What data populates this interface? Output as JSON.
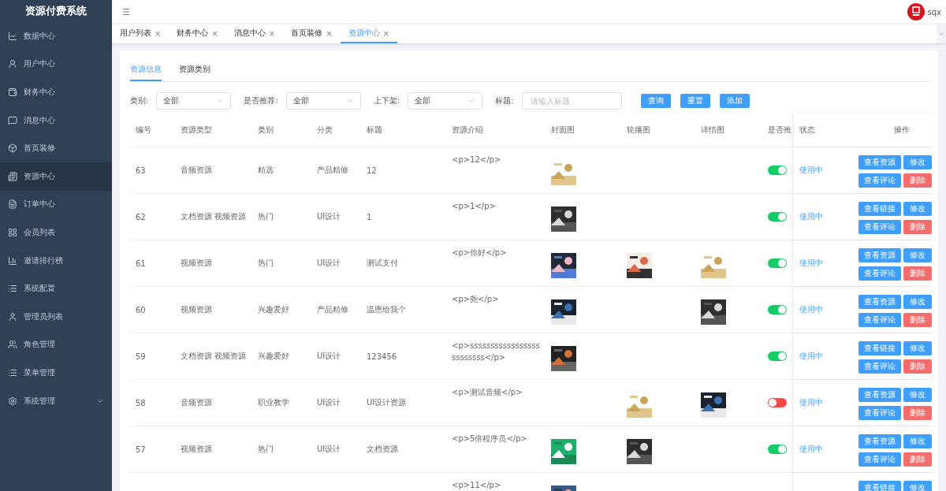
{
  "sidebar": {
    "title": "资源付费系统",
    "items": [
      {
        "label": "数据中心",
        "selected": false,
        "kind": "link"
      },
      {
        "label": "用户中心",
        "selected": false,
        "kind": "link"
      },
      {
        "label": "财务中心",
        "selected": false,
        "kind": "link"
      },
      {
        "label": "消息中心",
        "selected": false,
        "kind": "link"
      },
      {
        "label": "首页装修",
        "selected": false,
        "kind": "link"
      },
      {
        "label": "资源中心",
        "selected": true,
        "kind": "link"
      },
      {
        "label": "订单中心",
        "selected": false,
        "kind": "link"
      },
      {
        "label": "会员列表",
        "selected": false,
        "kind": "link"
      },
      {
        "label": "邀请排行榜",
        "selected": false,
        "kind": "link"
      },
      {
        "label": "系统配置",
        "selected": false,
        "kind": "link"
      },
      {
        "label": "管理员列表",
        "selected": false,
        "kind": "link"
      },
      {
        "label": "角色管理",
        "selected": false,
        "kind": "link"
      },
      {
        "label": "菜单管理",
        "selected": false,
        "kind": "link"
      },
      {
        "label": "系统管理",
        "selected": false,
        "kind": "submenu"
      }
    ]
  },
  "header": {
    "username": "sqx"
  },
  "tabs": [
    {
      "label": "用户列表",
      "close": "×",
      "selected": false
    },
    {
      "label": "财务中心",
      "close": "×",
      "selected": false
    },
    {
      "label": "消息中心",
      "close": "×",
      "selected": false
    },
    {
      "label": "首页装修",
      "close": "×",
      "selected": false
    },
    {
      "label": "资源中心",
      "close": "×",
      "selected": true
    }
  ],
  "subtabs": [
    {
      "label": "资源信息",
      "selected": true
    },
    {
      "label": "资源类别",
      "selected": false
    }
  ],
  "filters": [
    {
      "kind": "select",
      "label": "类别:",
      "value": "全部"
    },
    {
      "kind": "select",
      "label": "是否推荐:",
      "value": "全部"
    },
    {
      "kind": "select",
      "label": "上下架:",
      "value": "全部"
    },
    {
      "kind": "input",
      "label": "标题:",
      "placeholder": "请输入标题"
    }
  ],
  "filter_buttons": [
    "查询",
    "重置",
    "添加"
  ],
  "table": {
    "columns": [
      "编号",
      "资源类型",
      "类别",
      "分类",
      "标题",
      "资源介绍",
      "封面图",
      "轮播图",
      "详情图",
      "是否推",
      "状态",
      "操作"
    ],
    "rows": [
      {
        "id": "63",
        "type": "音频资源",
        "category": "精选",
        "class": "产品精修",
        "title": "12",
        "intro": "<p>12</p>",
        "cover": {
          "kind": "picture"
        },
        "recommended": true,
        "status": "使用中",
        "actions": [
          "查看资源",
          "修改",
          "查看评论",
          "删除"
        ]
      },
      {
        "id": "62",
        "type": "文档资源 视频资源",
        "category": "热门",
        "class": "UI设计",
        "title": "1",
        "intro": "<p>1</p>",
        "cover": {
          "kind": "picture"
        },
        "recommended": true,
        "status": "使用中",
        "actions": [
          "查看链接",
          "修改",
          "查看评论",
          "删除"
        ]
      },
      {
        "id": "61",
        "type": "视频资源",
        "category": "热门",
        "class": "UI设计",
        "title": "测试支付",
        "intro": "<p>你好</p>",
        "cover": {
          "kind": "picture"
        },
        "carousel": {
          "kind": "picture"
        },
        "detail": {
          "kind": "picture"
        },
        "recommended": true,
        "status": "使用中",
        "actions": [
          "查看资源",
          "修改",
          "查看评论",
          "删除"
        ]
      },
      {
        "id": "60",
        "type": "视频资源",
        "category": "兴趣爱好",
        "class": "产品精修",
        "title": "温恩给我个",
        "intro": "<p>尧</p>",
        "cover": {
          "kind": "picture"
        },
        "detail": {
          "kind": "picture"
        },
        "recommended": true,
        "status": "使用中",
        "actions": [
          "查看资源",
          "修改",
          "查看评论",
          "删除"
        ]
      },
      {
        "id": "59",
        "type": "文档资源 视频资源",
        "category": "兴趣爱好",
        "class": "UI设计",
        "title": "123456",
        "intro": "<p>sssssssssssssssssssssssss</p>",
        "cover": {
          "kind": "picture"
        },
        "recommended": true,
        "status": "使用中",
        "actions": [
          "查看链接",
          "修改",
          "查看评论",
          "删除"
        ]
      },
      {
        "id": "58",
        "type": "音频资源",
        "category": "职业教学",
        "class": "UI设计",
        "title": "UI设计资源",
        "intro": "<p>测试音频</p>",
        "carousel": {
          "kind": "picture"
        },
        "detail": {
          "kind": "picture"
        },
        "recommended": false,
        "status": "使用中",
        "actions": [
          "查看资源",
          "修改",
          "查看评论",
          "删除"
        ]
      },
      {
        "id": "57",
        "type": "视频资源",
        "category": "热门",
        "class": "UI设计",
        "title": "文档资源",
        "intro": "<p>5倍程序员</p>",
        "cover": {
          "kind": "picture"
        },
        "carousel": {
          "kind": "picture"
        },
        "recommended": true,
        "status": "使用中",
        "actions": [
          "查看资源",
          "修改",
          "查看评论",
          "删除"
        ]
      },
      {
        "intro": "<p>11</p>",
        "cover": {
          "kind": "picture"
        },
        "actions": [
          "查看链接",
          "修改"
        ]
      }
    ]
  }
}
